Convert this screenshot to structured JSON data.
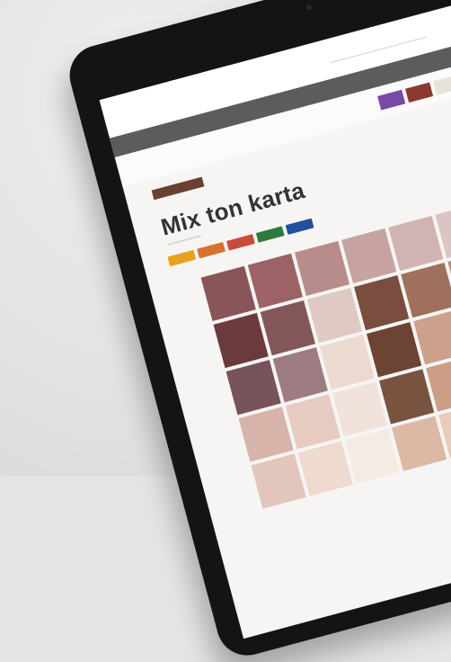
{
  "page": {
    "title": "Mix ton karta"
  },
  "colors": {
    "cta": "#e27538",
    "nav": "#5c5c5c",
    "brand_tag": "#6a4030",
    "filter_chips": [
      "#e6a21b",
      "#d9712c",
      "#c84b3a",
      "#2e7a3c",
      "#244f9c",
      "#7a49a6",
      "#8a3a30",
      "#e8e1da",
      "#cfcac6"
    ],
    "swatch_rows": [
      [
        "#8a5558",
        "#9c6266",
        "#b98c8c",
        "#c6a3a1",
        "#d2b3b3",
        "#dcc4c2",
        "#e3d2d0"
      ],
      [
        "#6a3a3c",
        "#83575a",
        "#dec9c3",
        "#7a4d3f",
        "#a0705f",
        "#b48d7d",
        "#cdb0a5"
      ],
      [
        "#77535a",
        "#9c7c80",
        "#ecdad1",
        "#6d4334",
        "#cba08c",
        "#ddbfb2",
        "#c19ba0"
      ],
      [
        "#d6b4a9",
        "#e7cbc0",
        "#f1e3dc",
        "#7a5240",
        "#cb9c86",
        "#eed7cb",
        "#d9b8a8"
      ],
      [
        "#e2c6bb",
        "#efdad0",
        "#f5ebe5",
        "#dbb9a5",
        "#e8cbb9",
        "#9b6a56",
        "#b37d62"
      ]
    ]
  }
}
